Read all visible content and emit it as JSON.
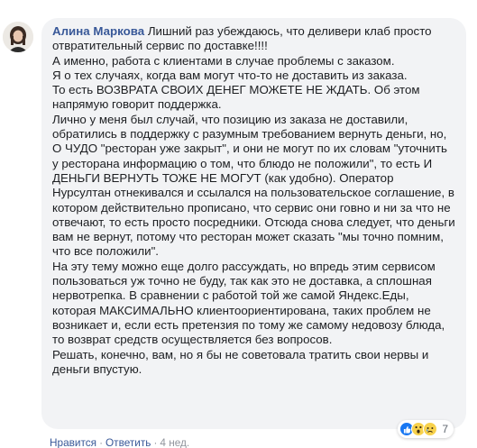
{
  "comment": {
    "author": "Алина Маркова",
    "first_line": "Лишний раз убеждаюсь, что деливери клаб просто отвратительный сервис по доставке!!!!",
    "paragraphs": [
      "А именно, работа с клиентами в случае проблемы с заказом.",
      "Я о тех случаях, когда вам могут что-то не доставить из заказа.",
      "То есть ВОЗВРАТА СВОИХ ДЕНЕГ МОЖЕТЕ НЕ ЖДАТЬ. Об этом напрямую говорит поддержка.",
      "Лично у меня был случай, что позицию из заказа не доставили, обратились в поддержку с разумным требованием вернуть деньги, но, О ЧУДО \"ресторан уже закрыт\", и они не могут по их словам \"уточнить у ресторана информацию о том, что блюдо не положили\", то есть И ДЕНЬГИ ВЕРНУТЬ ТОЖЕ НЕ МОГУТ (как удобно). Оператор Нурсултан отнекивался и ссылался на пользовательское соглашение, в котором действительно прописано, что сервис они говно и ни за что не отвечают, то есть просто посредники. Отсюда снова следует, что деньги вам не вернут, потому что ресторан может сказать \"мы точно помним, что все положили\".",
      "На эту тему можно еще долго рассуждать, но впредь этим сервисом пользоваться уж точно не буду, так как это не доставка, а сплошная нервотрепка. В сравнении с работой той же самой Яндекс.Еды, которая МАКСИМАЛЬНО клиентоориентирована, таких проблем не возникает и, если есть претензия по тому же самому недовозу блюда, то возврат средств осуществляется без вопросов.",
      "Решать, конечно, вам, но я бы не советовала тратить свои нервы и деньги впустую."
    ],
    "reaction_count": "7",
    "reaction_icons": [
      "like-icon",
      "wow-icon",
      "sad-icon"
    ],
    "actions": {
      "like": "Нравится",
      "reply": "Ответить",
      "separator": "·",
      "time": "4 нед."
    }
  },
  "colors": {
    "author_link": "#385898",
    "bubble_bg": "#f2f3f5",
    "text": "#1c1e21",
    "meta": "#90949c",
    "like_blue": "#1877f2",
    "emoji_yellow": "#f7d14c"
  }
}
